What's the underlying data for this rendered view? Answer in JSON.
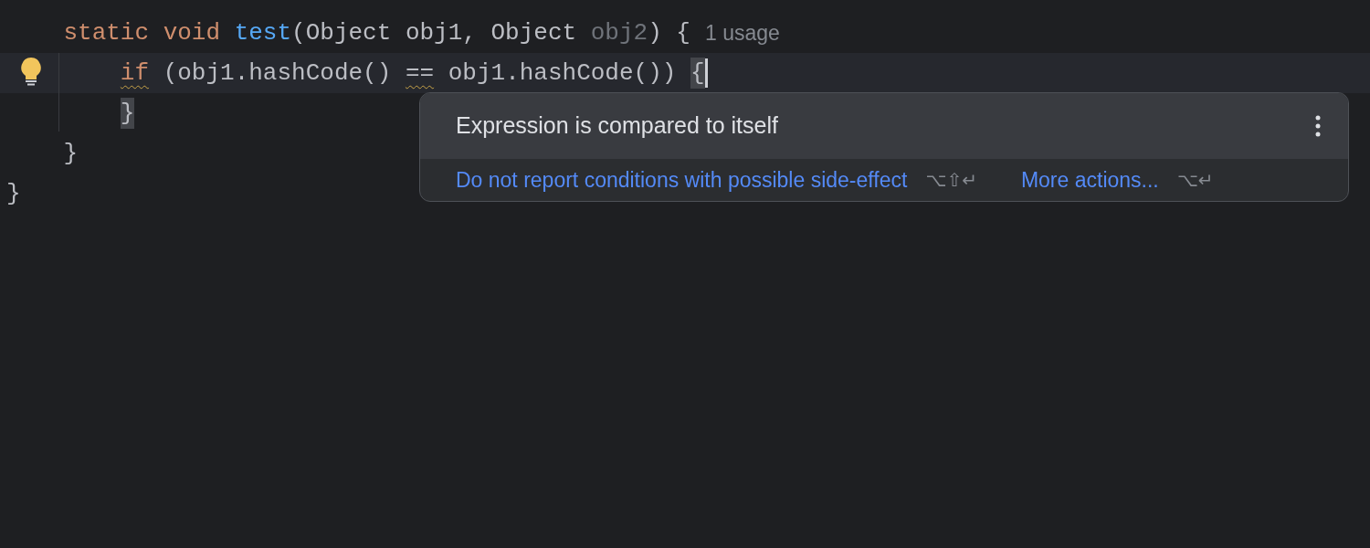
{
  "editor": {
    "lines": [
      {
        "current": false,
        "hint": "1 usage",
        "tokens": [
          {
            "text": "    static void ",
            "kind": "keyword",
            "warning": false,
            "matched": false
          },
          {
            "text": "test",
            "kind": "method",
            "warning": false,
            "matched": false
          },
          {
            "text": "(Object obj1, Object ",
            "kind": "plain",
            "warning": false,
            "matched": false
          },
          {
            "text": "obj2",
            "kind": "unused",
            "warning": false,
            "matched": false
          },
          {
            "text": ") {",
            "kind": "plain",
            "warning": false,
            "matched": false
          }
        ]
      },
      {
        "current": true,
        "tokens": [
          {
            "text": "        if",
            "kind": "keyword",
            "warning": true,
            "matched": false
          },
          {
            "text": " (obj1.hashCode() ",
            "kind": "plain",
            "warning": false,
            "matched": false
          },
          {
            "text": "==",
            "kind": "plain",
            "warning": true,
            "matched": false
          },
          {
            "text": " obj1.hashCode()) ",
            "kind": "plain",
            "warning": false,
            "matched": false
          },
          {
            "text": "{",
            "kind": "plain",
            "warning": false,
            "matched": true
          }
        ]
      },
      {
        "current": false,
        "tokens": [
          {
            "text": "        }",
            "kind": "plain",
            "warning": false,
            "matched": true
          }
        ]
      },
      {
        "current": false,
        "tokens": [
          {
            "text": "    }",
            "kind": "plain",
            "warning": false,
            "matched": false
          }
        ]
      },
      {
        "current": false,
        "tokens": [
          {
            "text": "}",
            "kind": "plain",
            "warning": false,
            "matched": false
          }
        ]
      }
    ]
  },
  "popup": {
    "title": "Expression is compared to itself",
    "actions": [
      {
        "label": "Do not report conditions with possible side-effect",
        "shortcut": "⌥⇧↵"
      },
      {
        "label": "More actions...",
        "shortcut": "⌥↵"
      }
    ]
  }
}
